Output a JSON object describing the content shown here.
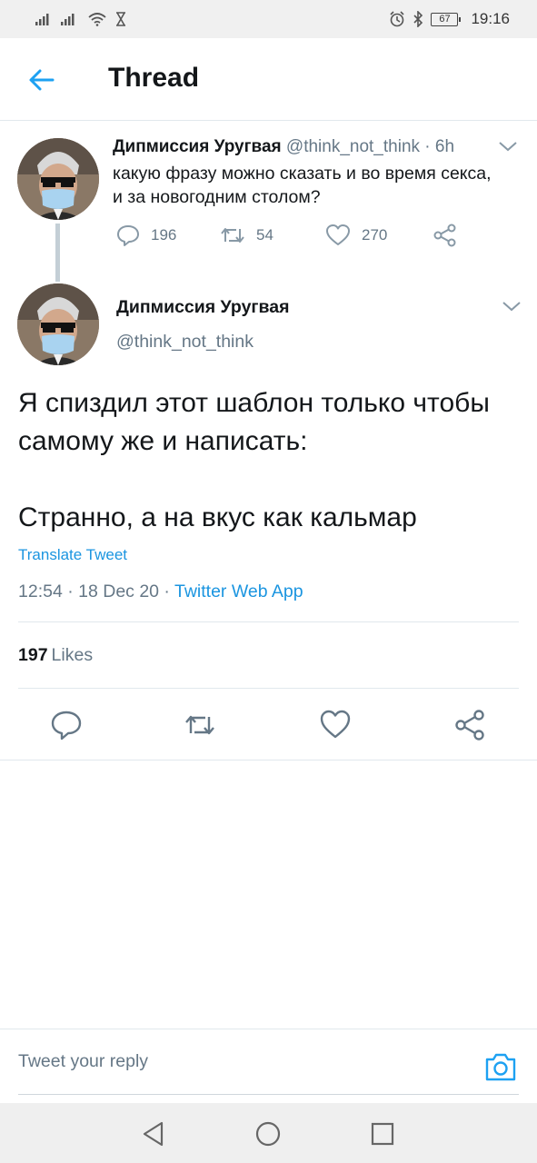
{
  "status_bar": {
    "time": "19:16",
    "battery": "67"
  },
  "header": {
    "title": "Thread"
  },
  "parent_tweet": {
    "name": "Дипмиссия Уругвая",
    "handle": "@think_not_think",
    "age": "· 6h",
    "text": "какую фразу можно сказать и во время секса, и за новогодним столом?",
    "replies": "196",
    "retweets": "54",
    "likes": "270"
  },
  "main_tweet": {
    "name": "Дипмиссия Уругвая",
    "handle": "@think_not_think",
    "text": "Я спиздил этот шаблон только чтобы самому же и написать:\n\nСтранно, а на вкус как кальмар",
    "translate_label": "Translate Tweet",
    "time": "12:54 · 18 Dec 20 · ",
    "source": "Twitter Web App",
    "likes_count": "197",
    "likes_label": "Likes"
  },
  "reply": {
    "placeholder": "Tweet your reply"
  },
  "colors": {
    "accent": "#1da1f2",
    "muted": "#657786",
    "text": "#14171a",
    "divider": "#e1e8ed"
  }
}
